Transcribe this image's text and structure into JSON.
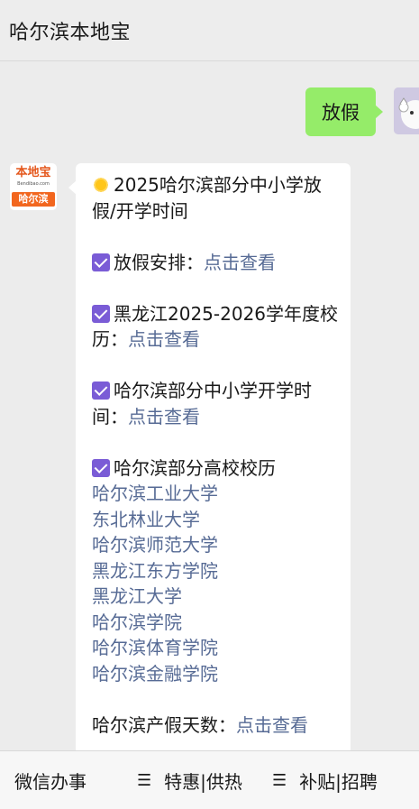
{
  "header": {
    "title": "哈尔滨本地宝"
  },
  "chat": {
    "outgoing": {
      "text": "放假"
    },
    "bot": {
      "logo_top": "本地宝",
      "logo_url": "Bendibao.com",
      "logo_bottom": "哈尔滨",
      "title": "2025哈尔滨部分中小学放假/开学时间",
      "items": [
        {
          "label": "放假安排：",
          "link": "点击查看"
        },
        {
          "label": "黑龙江2025-2026学年度校历：",
          "link": "点击查看"
        },
        {
          "label": "哈尔滨部分中小学开学时间：",
          "link": "点击查看"
        }
      ],
      "colleges_title": "哈尔滨部分高校校历",
      "colleges": [
        "哈尔滨工业大学",
        "东北林业大学",
        "哈尔滨师范大学",
        "黑龙江东方学院",
        "黑龙江大学",
        "哈尔滨学院",
        "哈尔滨体育学院",
        "哈尔滨金融学院"
      ],
      "maternity": {
        "label": "哈尔滨产假天数：",
        "link": "点击查看"
      }
    }
  },
  "bottom_bar": {
    "items": [
      "微信办事",
      "特惠|供热",
      "补贴|招聘"
    ],
    "menu_icon": "☰"
  },
  "colors": {
    "link": "#576b95",
    "outgoing_bubble": "#95ec69",
    "check": "#7a5cd6"
  }
}
